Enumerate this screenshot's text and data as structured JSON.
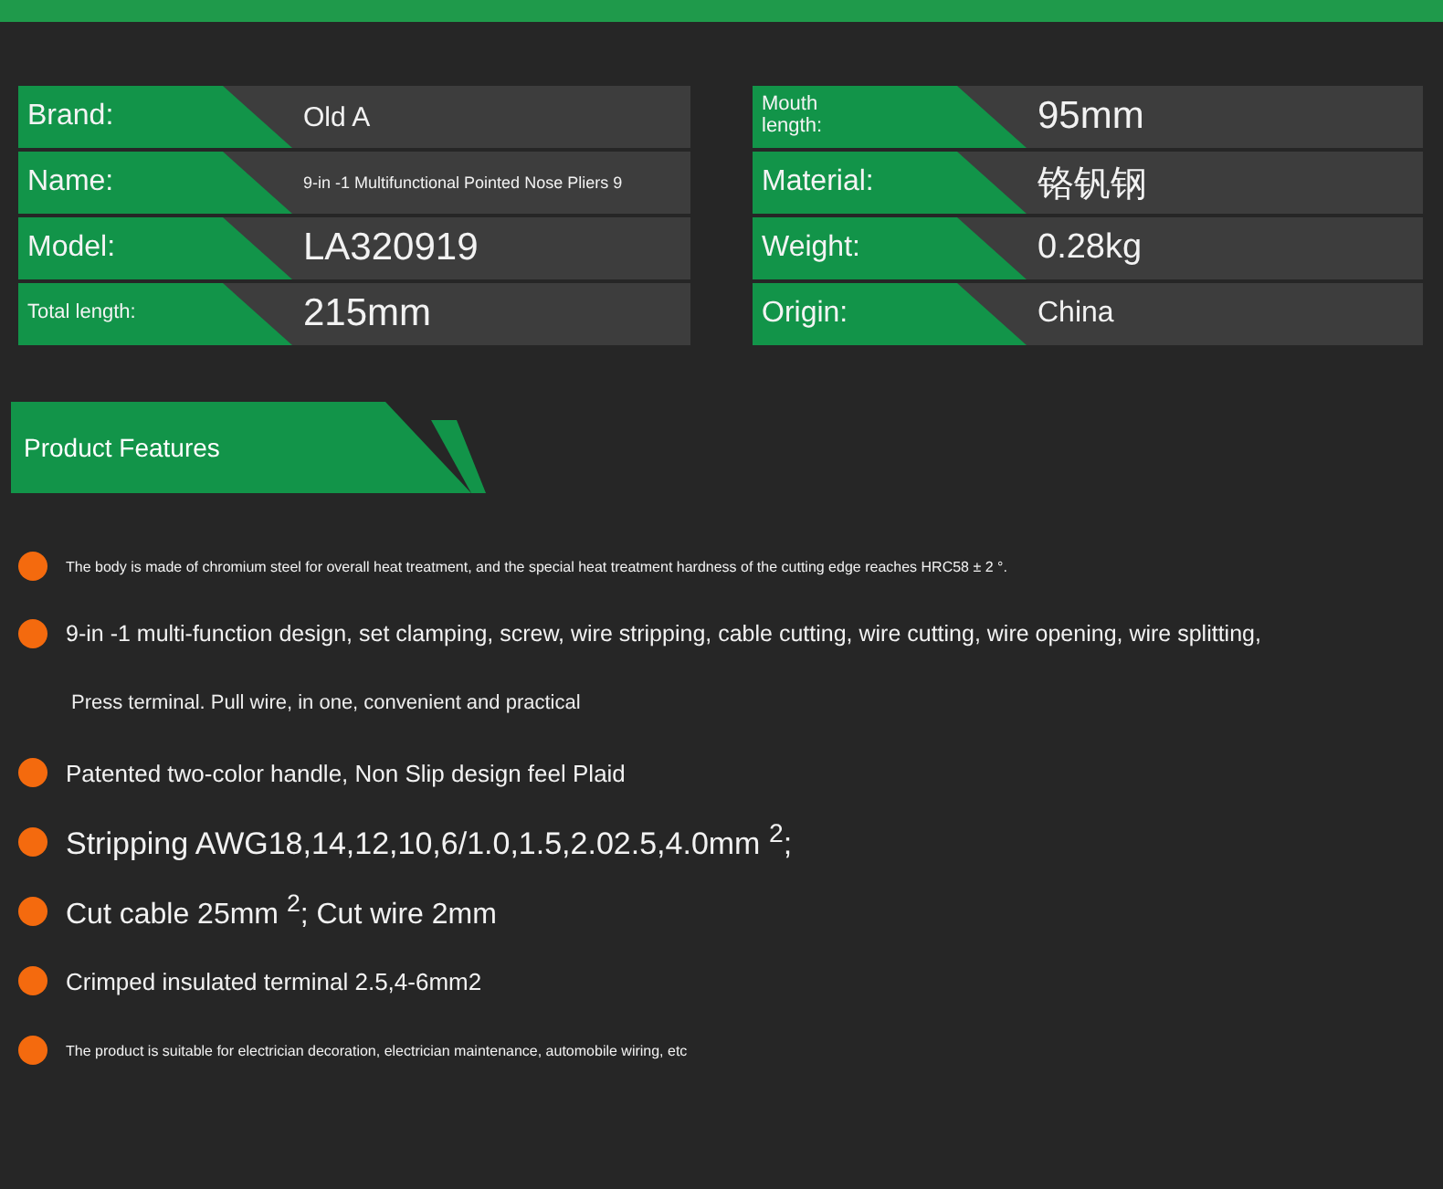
{
  "specs_left": [
    {
      "label": "Brand:",
      "value": "Old A"
    },
    {
      "label": "Name:",
      "value": "9-in -1 Multifunctional Pointed Nose Pliers 9"
    },
    {
      "label": "Model:",
      "value": "LA320919"
    },
    {
      "label": "Total length:",
      "value": "215mm"
    }
  ],
  "specs_right": [
    {
      "label": "Mouth length:",
      "value": "95mm"
    },
    {
      "label": "Material:",
      "value": "铬钒钢"
    },
    {
      "label": "Weight:",
      "value": "0.28kg"
    },
    {
      "label": "Origin:",
      "value": "China"
    }
  ],
  "features_title": "Product Features",
  "features": [
    {
      "text": "The body is made of chromium steel for overall heat treatment, and the special heat treatment hardness of the cutting edge reaches HRC58 ± 2 °."
    },
    {
      "text": "9-in -1 multi-function design, set clamping, screw, wire stripping, cable cutting, wire cutting, wire opening, wire splitting,",
      "continuation": "Press terminal. Pull wire, in one, convenient and practical"
    },
    {
      "text": "Patented two-color handle, Non Slip design feel Plaid"
    },
    {
      "text": "Stripping AWG18,14,12,10,6/1.0,1.5,2.02.5,4.0mm $^{2}$;"
    },
    {
      "text": "Cut cable 25mm $^{2}$; Cut wire 2mm"
    },
    {
      "text": "Crimped insulated terminal 2.5,4-6mm2"
    },
    {
      "text": "The product is suitable for electrician decoration, electrician maintenance, automobile wiring, etc"
    }
  ]
}
